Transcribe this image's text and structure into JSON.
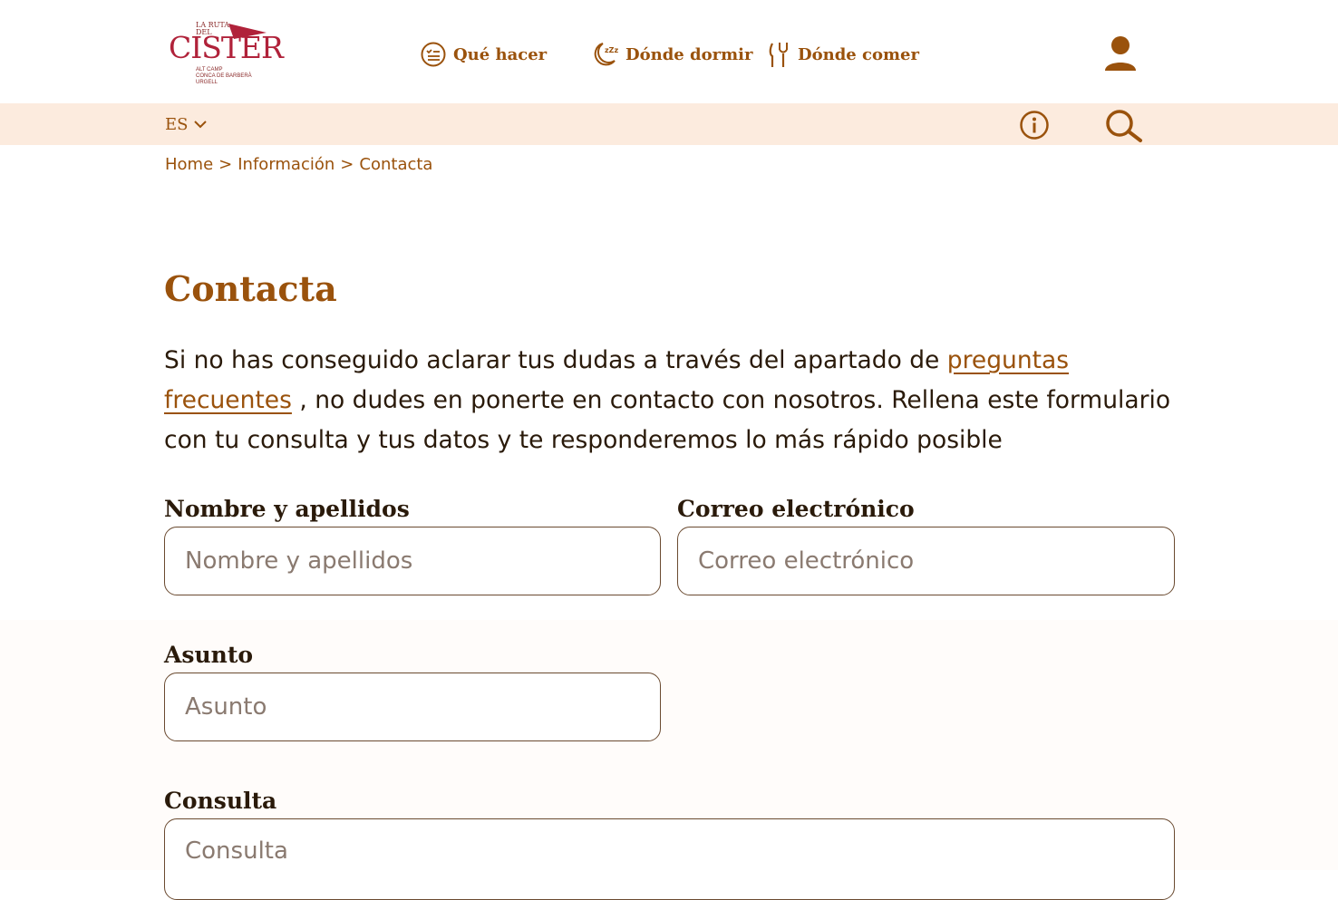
{
  "logo": {
    "line1": "LA RUTA",
    "line2": "DEL",
    "main": "CISTER",
    "sub1": "ALT CAMP",
    "sub2": "CONCA DE BARBERÀ",
    "sub3": "URGELL"
  },
  "nav": {
    "items": [
      {
        "label": "Qué hacer",
        "icon": "checklist-icon"
      },
      {
        "label": "Dónde dormir",
        "icon": "moon-sleep-icon"
      },
      {
        "label": "Dónde comer",
        "icon": "cutlery-icon"
      }
    ],
    "user_icon": "user-icon"
  },
  "subbar": {
    "language": "ES",
    "info_icon": "info-icon",
    "search_icon": "search-icon"
  },
  "breadcrumb": {
    "items": [
      "Home",
      "Información",
      "Contacta"
    ],
    "separator": ">"
  },
  "page": {
    "title": "Contacta",
    "intro_before": "Si no has conseguido aclarar tus dudas a través del apartado de ",
    "intro_link": "preguntas frecuentes",
    "intro_after": " , no dudes en ponerte en contacto con nosotros. Rellena este formulario con tu consulta y tus datos y te responderemos lo más rápido posible"
  },
  "form": {
    "name_label": "Nombre y apellidos",
    "name_placeholder": "Nombre y apellidos",
    "email_label": "Correo electrónico",
    "email_placeholder": "Correo electrónico",
    "subject_label": "Asunto",
    "subject_placeholder": "Asunto",
    "query_label": "Consulta",
    "query_placeholder": "Consulta"
  },
  "colors": {
    "accent": "#9a520c",
    "logo_red": "#b0223a",
    "subbar_bg": "#fcebde",
    "text": "#2a1a0a"
  }
}
